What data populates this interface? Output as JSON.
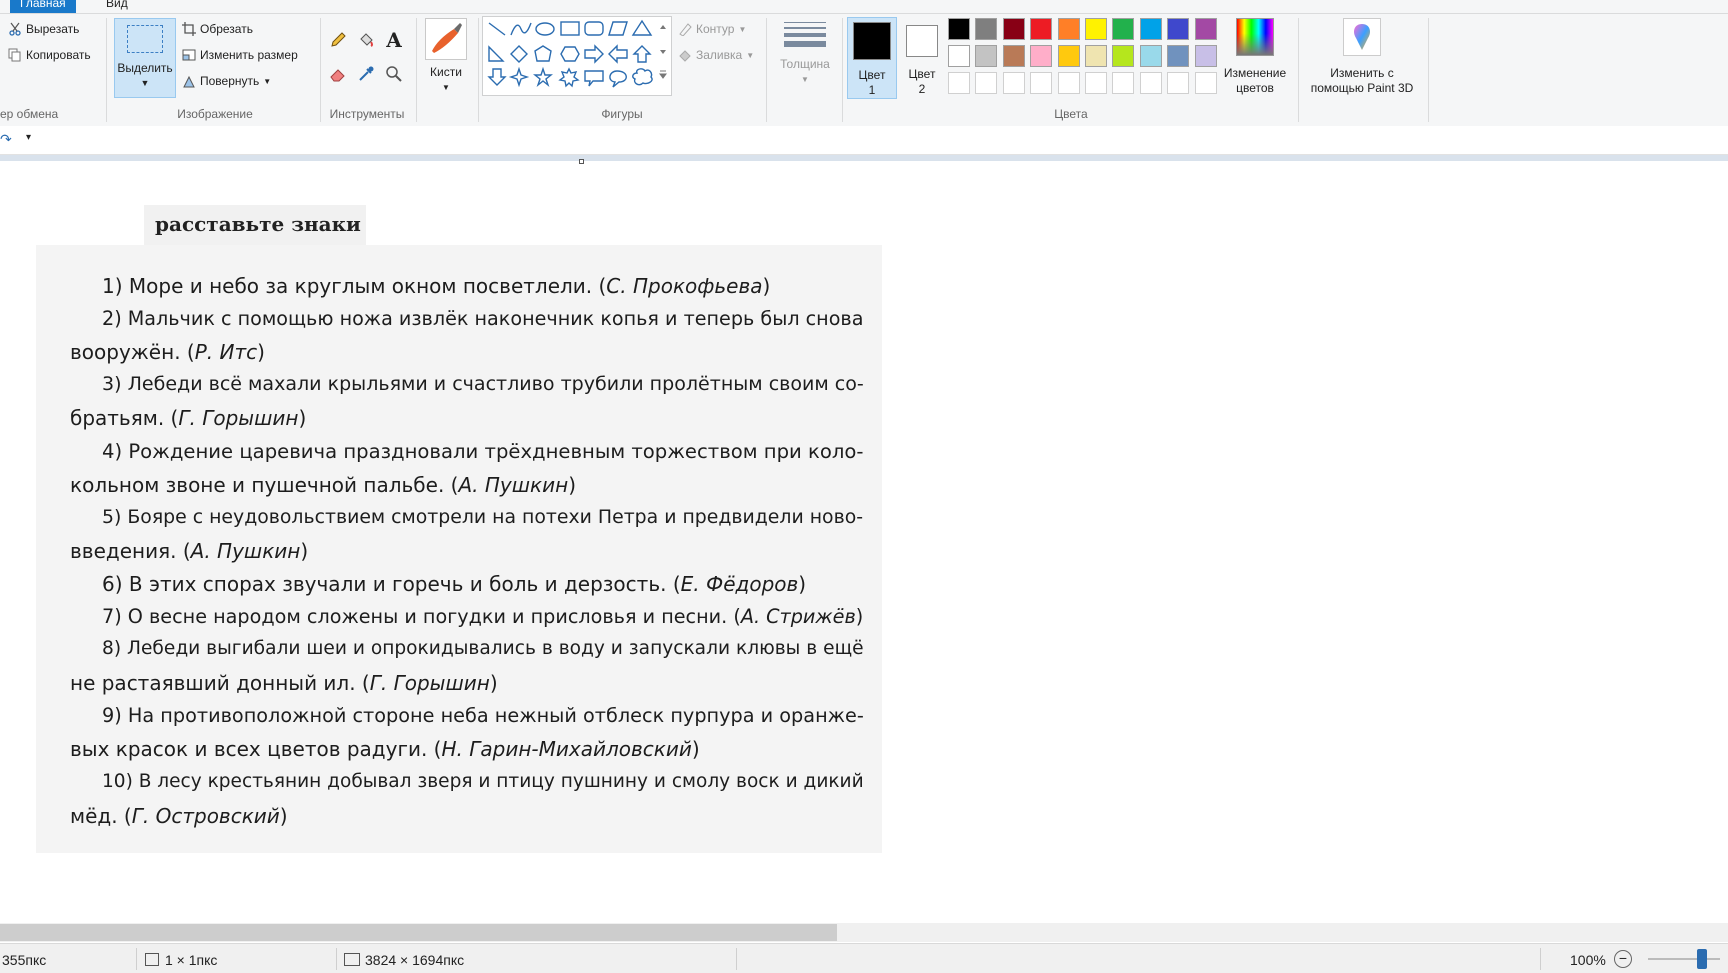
{
  "tabs": [
    "Главная",
    "Вид"
  ],
  "clipboard": {
    "cut": "Вырезать",
    "copy": "Копировать",
    "group_label": "ер обмена"
  },
  "image": {
    "select": "Выделить",
    "crop": "Обрезать",
    "resize": "Изменить размер",
    "rotate": "Повернуть",
    "group_label": "Изображение"
  },
  "tools": {
    "group_label": "Инструменты",
    "brushes": "Кисти"
  },
  "shapes": {
    "outline": "Контур",
    "fill": "Заливка",
    "group_label": "Фигуры"
  },
  "size": {
    "label": "Толщина"
  },
  "colors": {
    "color1": "Цвет",
    "color1_num": "1",
    "color2": "Цвет",
    "color2_num": "2",
    "edit_colors_1": "Изменение",
    "edit_colors_2": "цветов",
    "group_label": "Цвета",
    "palette_row1": [
      "#000000",
      "#7f7f7f",
      "#880015",
      "#ed1c24",
      "#ff7f27",
      "#fff200",
      "#22b14c",
      "#00a2e8",
      "#3f48cc",
      "#a349a4"
    ],
    "palette_row2": [
      "#ffffff",
      "#c3c3c3",
      "#b97a57",
      "#ffaec9",
      "#ffc90e",
      "#efe4b0",
      "#b5e61d",
      "#99d9ea",
      "#7092be",
      "#c8bfe7"
    ]
  },
  "paint3d": {
    "line1": "Изменить с",
    "line2": "помощью Paint 3D"
  },
  "document": {
    "heading": "расставьте знаки",
    "lines": [
      {
        "t": "1) Море и небо за круглым окном посветлели. (",
        "a": "С. Прокофьева",
        "e": ")",
        "indent": true
      },
      {
        "t": "2) Мальчик с помощью ножа извлёк наконечник копья и теперь был снова",
        "a": "",
        "e": "",
        "indent": true
      },
      {
        "t": "вооружён. (",
        "a": "Р. Итс",
        "e": ")",
        "indent": false
      },
      {
        "t": "3) Лебеди всё махали крыльями и счастливо трубили пролётным своим со-",
        "a": "",
        "e": "",
        "indent": true
      },
      {
        "t": "братьям. (",
        "a": "Г. Горышин",
        "e": ")",
        "indent": false
      },
      {
        "t": "4) Рождение царевича праздновали трёхдневным торжеством при коло-",
        "a": "",
        "e": "",
        "indent": true
      },
      {
        "t": "кольном звоне и пушечной пальбе. (",
        "a": "А. Пушкин",
        "e": ")",
        "indent": false
      },
      {
        "t": "5) Бояре с неудовольствием смотрели на потехи Петра и предвидели ново-",
        "a": "",
        "e": "",
        "indent": true
      },
      {
        "t": "введения. (",
        "a": "А. Пушкин",
        "e": ")",
        "indent": false
      },
      {
        "t": "6) В этих спорах звучали и горечь и боль и дерзость. (",
        "a": "Е. Фёдоров",
        "e": ")",
        "indent": true
      },
      {
        "t": "7) О весне народом сложены и погудки и присловья и песни. (",
        "a": "А. Стрижёв",
        "e": ")",
        "indent": true
      },
      {
        "t": "8) Лебеди выгибали шеи и опрокидывались в воду и запускали клювы в ещё",
        "a": "",
        "e": "",
        "indent": true
      },
      {
        "t": "не растаявший донный ил. (",
        "a": "Г. Горышин",
        "e": ")",
        "indent": false
      },
      {
        "t": "9) На противоположной стороне неба нежный отблеск пурпура и оранже-",
        "a": "",
        "e": "",
        "indent": true
      },
      {
        "t": "вых красок и всех цветов радуги. (",
        "a": "Н. Гарин-Михайловский",
        "e": ")",
        "indent": false
      },
      {
        "t": "10) В лесу крестьянин добывал зверя и птицу пушнину и смолу воск и дикий",
        "a": "",
        "e": "",
        "indent": true
      },
      {
        "t": "мёд. (",
        "a": "Г. Островский",
        "e": ")",
        "indent": false
      }
    ]
  },
  "status": {
    "position": "355пкс",
    "selection": "1 × 1пкс",
    "image_size": "3824 × 1694пкс",
    "zoom": "100%"
  }
}
